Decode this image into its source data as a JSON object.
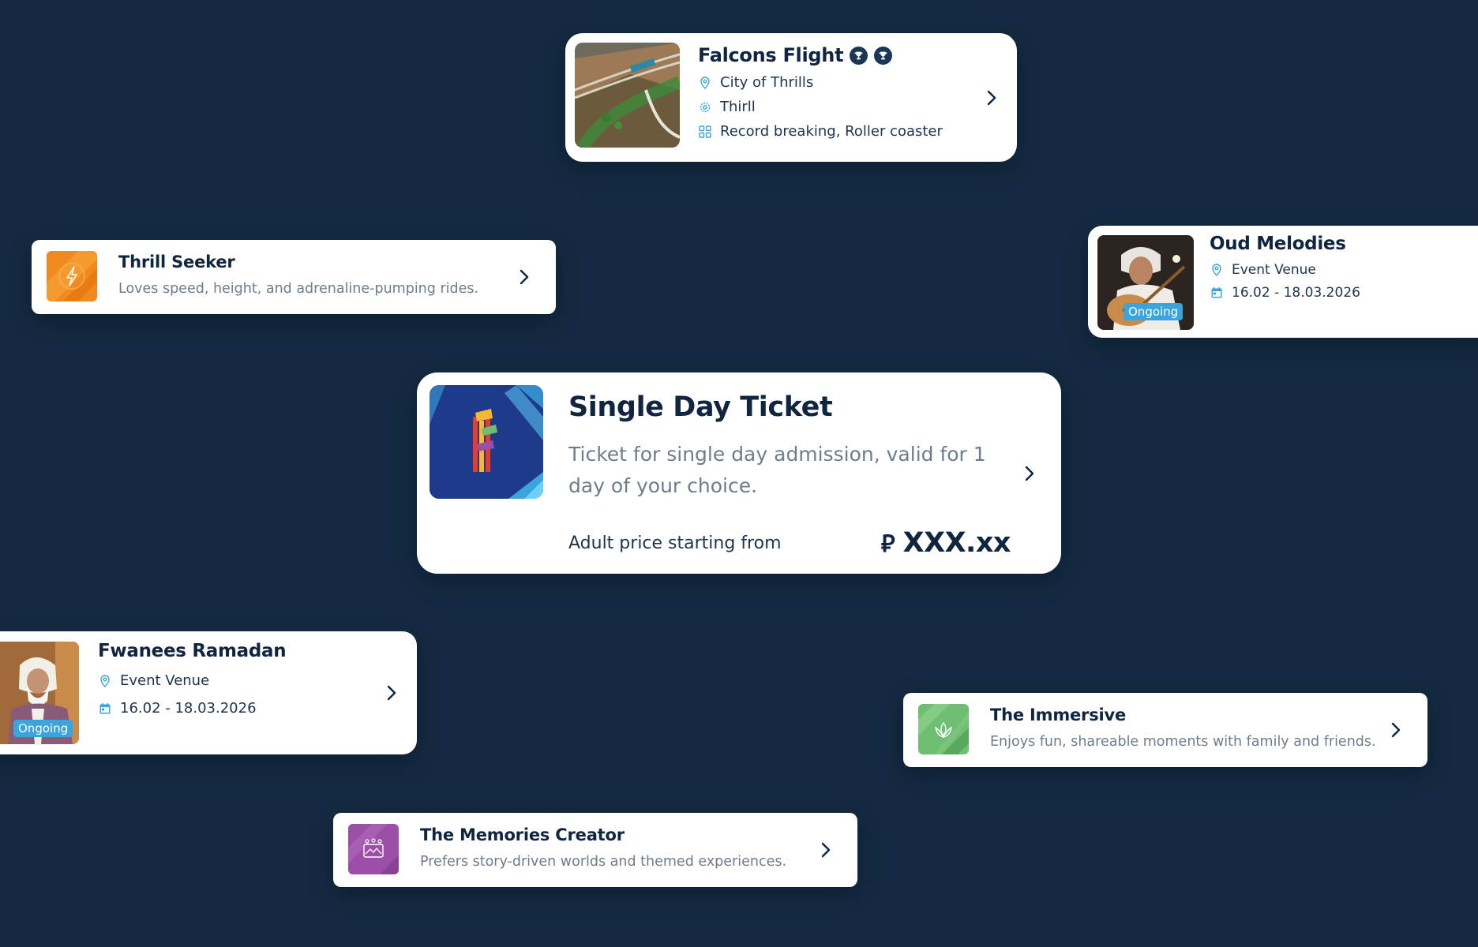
{
  "falcons_flight": {
    "title": "Falcons Flight",
    "location": "City of Thrills",
    "category": "Thirll",
    "tags": "Record breaking, Roller coaster",
    "icons": [
      "trophy-icon",
      "trophy-icon",
      "map-pin-icon",
      "gear-icon",
      "grid-icon",
      "chevron-right-icon"
    ]
  },
  "personas": [
    {
      "title": "Thrill Seeker",
      "description": "Loves speed, height, and adrenaline-pumping rides.",
      "color": "#f08a1e",
      "icon": "lightning-icon"
    },
    {
      "title": "The Immersive",
      "description": "Enjoys fun, shareable moments with family and friends.",
      "color": "#6fbf73",
      "icon": "lotus-icon"
    },
    {
      "title": "The Memories Creator",
      "description": "Prefers story-driven worlds and themed experiences.",
      "color": "#9b4fa6",
      "icon": "photo-icon"
    }
  ],
  "events": [
    {
      "title": "Oud Melodies",
      "venue": "Event Venue",
      "dates": "16.02 - 18.03.2026",
      "status": "Ongoing"
    },
    {
      "title": "Fwanees Ramadan",
      "venue": "Event Venue",
      "dates": "16.02 - 18.03.2026",
      "status": "Ongoing"
    }
  ],
  "ticket": {
    "title": "Single Day Ticket",
    "description": "Ticket for single day admission, valid for 1 day of your choice.",
    "price_label": "Adult price starting from",
    "currency_symbol": "⃁",
    "price": "XXX.xx"
  },
  "colors": {
    "background": "#132a42",
    "accent": "#3aa4dc",
    "text": "#0f2540",
    "muted": "#6f7c8b"
  }
}
